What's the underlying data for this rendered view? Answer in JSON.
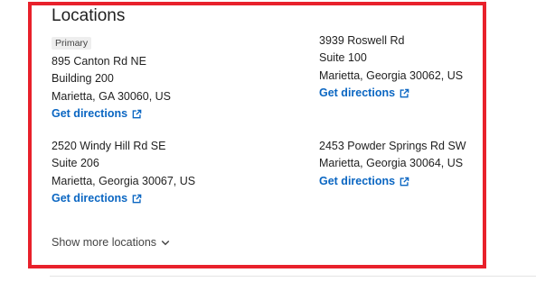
{
  "section": {
    "title": "Locations"
  },
  "locations": [
    {
      "badge": "Primary",
      "lines": [
        "895 Canton Rd NE",
        "Building 200",
        "Marietta, GA 30060, US"
      ],
      "directions_label": "Get directions"
    },
    {
      "lines": [
        "3939 Roswell Rd",
        "Suite 100",
        "Marietta, Georgia 30062, US"
      ],
      "directions_label": "Get directions"
    },
    {
      "lines": [
        "2520 Windy Hill Rd SE",
        "Suite 206",
        "Marietta, Georgia 30067, US"
      ],
      "directions_label": "Get directions"
    },
    {
      "lines": [
        "2453 Powder Springs Rd SW",
        "Marietta, Georgia 30064, US"
      ],
      "directions_label": "Get directions"
    }
  ],
  "show_more": {
    "label": "Show more locations",
    "icon": "chevron-down-icon"
  },
  "icons": {
    "directions": "external-link-icon"
  },
  "colors": {
    "link": "#0a66c2",
    "highlight_frame": "#e8212b",
    "badge_bg": "#eeeeee",
    "text": "#1f1f1f"
  }
}
